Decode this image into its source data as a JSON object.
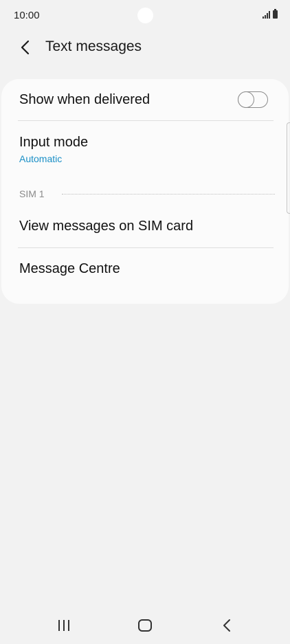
{
  "status_bar": {
    "time": "10:00"
  },
  "header": {
    "title": "Text messages",
    "back_icon": "chevron-left-icon"
  },
  "settings": {
    "show_when_delivered": {
      "label": "Show when delivered",
      "enabled": false
    },
    "input_mode": {
      "label": "Input mode",
      "value": "Automatic"
    },
    "sim_section": {
      "label": "SIM 1",
      "items": [
        {
          "label": "View messages on SIM card"
        },
        {
          "label": "Message Centre"
        }
      ]
    }
  },
  "nav_bar": {
    "icons": [
      "recent-apps-icon",
      "home-icon",
      "back-icon"
    ]
  },
  "colors": {
    "accent": "#1a8fc6",
    "background": "#f2f2f2",
    "card": "#fbfbfb"
  }
}
